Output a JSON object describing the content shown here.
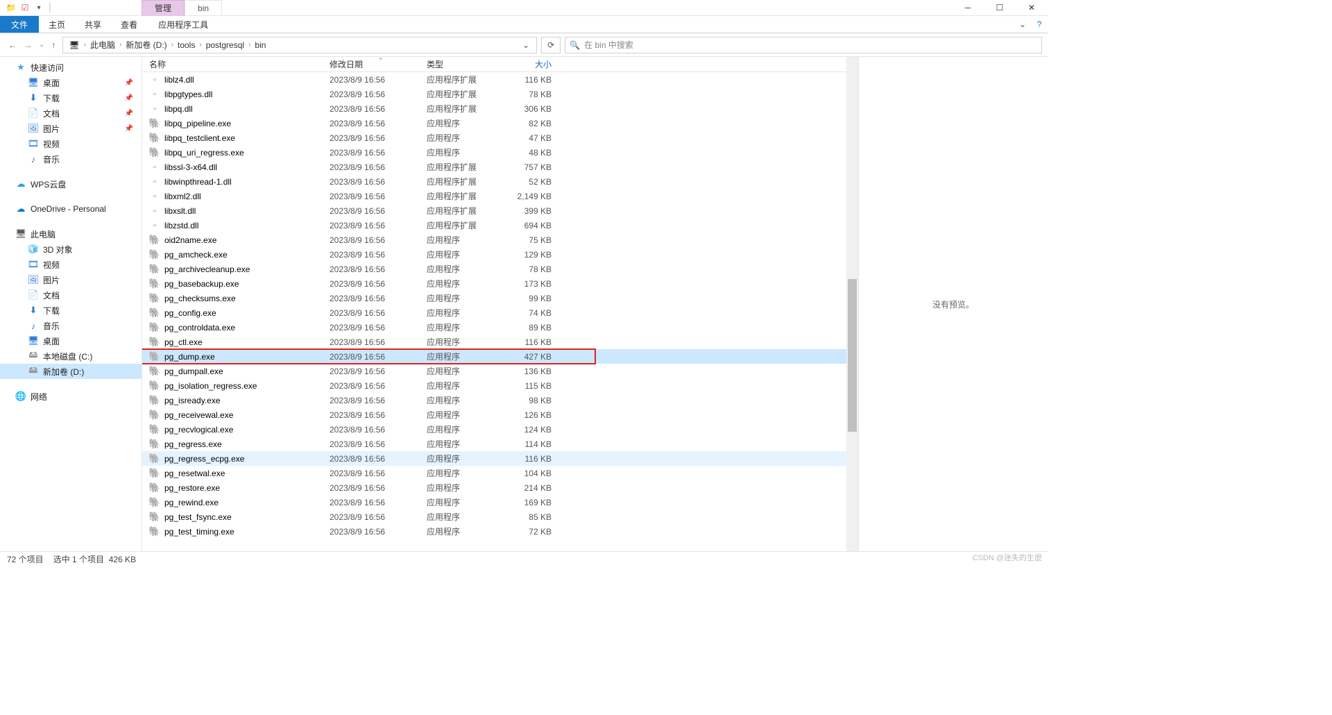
{
  "titlebar": {
    "manage": "管理",
    "folder": "bin"
  },
  "ribbon": {
    "file": "文件",
    "home": "主页",
    "share": "共享",
    "view": "查看",
    "apptools": "应用程序工具"
  },
  "addr": {
    "pc": "此电脑",
    "d": "新加卷 (D:)",
    "tools": "tools",
    "pg": "postgresql",
    "bin": "bin"
  },
  "search_placeholder": "在 bin 中搜索",
  "sidebar": {
    "quick": "快速访问",
    "desktop": "桌面",
    "download": "下载",
    "docs": "文档",
    "pics": "图片",
    "video": "视频",
    "music": "音乐",
    "wps": "WPS云盘",
    "onedrive": "OneDrive - Personal",
    "pc": "此电脑",
    "obj3d": "3D 对象",
    "video2": "视频",
    "pics2": "图片",
    "docs2": "文档",
    "download2": "下载",
    "music2": "音乐",
    "desktop2": "桌面",
    "diskc": "本地磁盘 (C:)",
    "diskd": "新加卷 (D:)",
    "network": "网络"
  },
  "cols": {
    "name": "名称",
    "date": "修改日期",
    "type": "类型",
    "size": "大小"
  },
  "type_ext": "应用程序扩展",
  "type_app": "应用程序",
  "files": [
    {
      "n": "liblz4.dll",
      "d": "2023/8/9 16:56",
      "t": "应用程序扩展",
      "s": "116 KB",
      "ico": "dll"
    },
    {
      "n": "libpgtypes.dll",
      "d": "2023/8/9 16:56",
      "t": "应用程序扩展",
      "s": "78 KB",
      "ico": "dll"
    },
    {
      "n": "libpq.dll",
      "d": "2023/8/9 16:56",
      "t": "应用程序扩展",
      "s": "306 KB",
      "ico": "dll"
    },
    {
      "n": "libpq_pipeline.exe",
      "d": "2023/8/9 16:56",
      "t": "应用程序",
      "s": "82 KB",
      "ico": "exe"
    },
    {
      "n": "libpq_testclient.exe",
      "d": "2023/8/9 16:56",
      "t": "应用程序",
      "s": "47 KB",
      "ico": "exe"
    },
    {
      "n": "libpq_uri_regress.exe",
      "d": "2023/8/9 16:56",
      "t": "应用程序",
      "s": "48 KB",
      "ico": "exe"
    },
    {
      "n": "libssl-3-x64.dll",
      "d": "2023/8/9 16:56",
      "t": "应用程序扩展",
      "s": "757 KB",
      "ico": "dll"
    },
    {
      "n": "libwinpthread-1.dll",
      "d": "2023/8/9 16:56",
      "t": "应用程序扩展",
      "s": "52 KB",
      "ico": "dll"
    },
    {
      "n": "libxml2.dll",
      "d": "2023/8/9 16:56",
      "t": "应用程序扩展",
      "s": "2,149 KB",
      "ico": "dll"
    },
    {
      "n": "libxslt.dll",
      "d": "2023/8/9 16:56",
      "t": "应用程序扩展",
      "s": "399 KB",
      "ico": "dll"
    },
    {
      "n": "libzstd.dll",
      "d": "2023/8/9 16:56",
      "t": "应用程序扩展",
      "s": "694 KB",
      "ico": "dll"
    },
    {
      "n": "oid2name.exe",
      "d": "2023/8/9 16:56",
      "t": "应用程序",
      "s": "75 KB",
      "ico": "exe"
    },
    {
      "n": "pg_amcheck.exe",
      "d": "2023/8/9 16:56",
      "t": "应用程序",
      "s": "129 KB",
      "ico": "exe"
    },
    {
      "n": "pg_archivecleanup.exe",
      "d": "2023/8/9 16:56",
      "t": "应用程序",
      "s": "78 KB",
      "ico": "exe"
    },
    {
      "n": "pg_basebackup.exe",
      "d": "2023/8/9 16:56",
      "t": "应用程序",
      "s": "173 KB",
      "ico": "exe"
    },
    {
      "n": "pg_checksums.exe",
      "d": "2023/8/9 16:56",
      "t": "应用程序",
      "s": "99 KB",
      "ico": "exe"
    },
    {
      "n": "pg_config.exe",
      "d": "2023/8/9 16:56",
      "t": "应用程序",
      "s": "74 KB",
      "ico": "exe"
    },
    {
      "n": "pg_controldata.exe",
      "d": "2023/8/9 16:56",
      "t": "应用程序",
      "s": "89 KB",
      "ico": "exe"
    },
    {
      "n": "pg_ctl.exe",
      "d": "2023/8/9 16:56",
      "t": "应用程序",
      "s": "116 KB",
      "ico": "exe"
    },
    {
      "n": "pg_dump.exe",
      "d": "2023/8/9 16:56",
      "t": "应用程序",
      "s": "427 KB",
      "ico": "exe",
      "sel": true,
      "red": true
    },
    {
      "n": "pg_dumpall.exe",
      "d": "2023/8/9 16:56",
      "t": "应用程序",
      "s": "136 KB",
      "ico": "exe"
    },
    {
      "n": "pg_isolation_regress.exe",
      "d": "2023/8/9 16:56",
      "t": "应用程序",
      "s": "115 KB",
      "ico": "exe"
    },
    {
      "n": "pg_isready.exe",
      "d": "2023/8/9 16:56",
      "t": "应用程序",
      "s": "98 KB",
      "ico": "exe"
    },
    {
      "n": "pg_receivewal.exe",
      "d": "2023/8/9 16:56",
      "t": "应用程序",
      "s": "126 KB",
      "ico": "exe"
    },
    {
      "n": "pg_recvlogical.exe",
      "d": "2023/8/9 16:56",
      "t": "应用程序",
      "s": "124 KB",
      "ico": "exe"
    },
    {
      "n": "pg_regress.exe",
      "d": "2023/8/9 16:56",
      "t": "应用程序",
      "s": "114 KB",
      "ico": "exe"
    },
    {
      "n": "pg_regress_ecpg.exe",
      "d": "2023/8/9 16:56",
      "t": "应用程序",
      "s": "116 KB",
      "ico": "exe",
      "hov": true
    },
    {
      "n": "pg_resetwal.exe",
      "d": "2023/8/9 16:56",
      "t": "应用程序",
      "s": "104 KB",
      "ico": "exe"
    },
    {
      "n": "pg_restore.exe",
      "d": "2023/8/9 16:56",
      "t": "应用程序",
      "s": "214 KB",
      "ico": "exe"
    },
    {
      "n": "pg_rewind.exe",
      "d": "2023/8/9 16:56",
      "t": "应用程序",
      "s": "169 KB",
      "ico": "exe"
    },
    {
      "n": "pg_test_fsync.exe",
      "d": "2023/8/9 16:56",
      "t": "应用程序",
      "s": "85 KB",
      "ico": "exe"
    },
    {
      "n": "pg_test_timing.exe",
      "d": "2023/8/9 16:56",
      "t": "应用程序",
      "s": "72 KB",
      "ico": "exe"
    }
  ],
  "preview_text": "没有预览。",
  "status": {
    "total": "72 个项目",
    "sel": "选中 1 个项目",
    "size": "426 KB"
  },
  "watermark": "CSDN @迷失的生麽"
}
